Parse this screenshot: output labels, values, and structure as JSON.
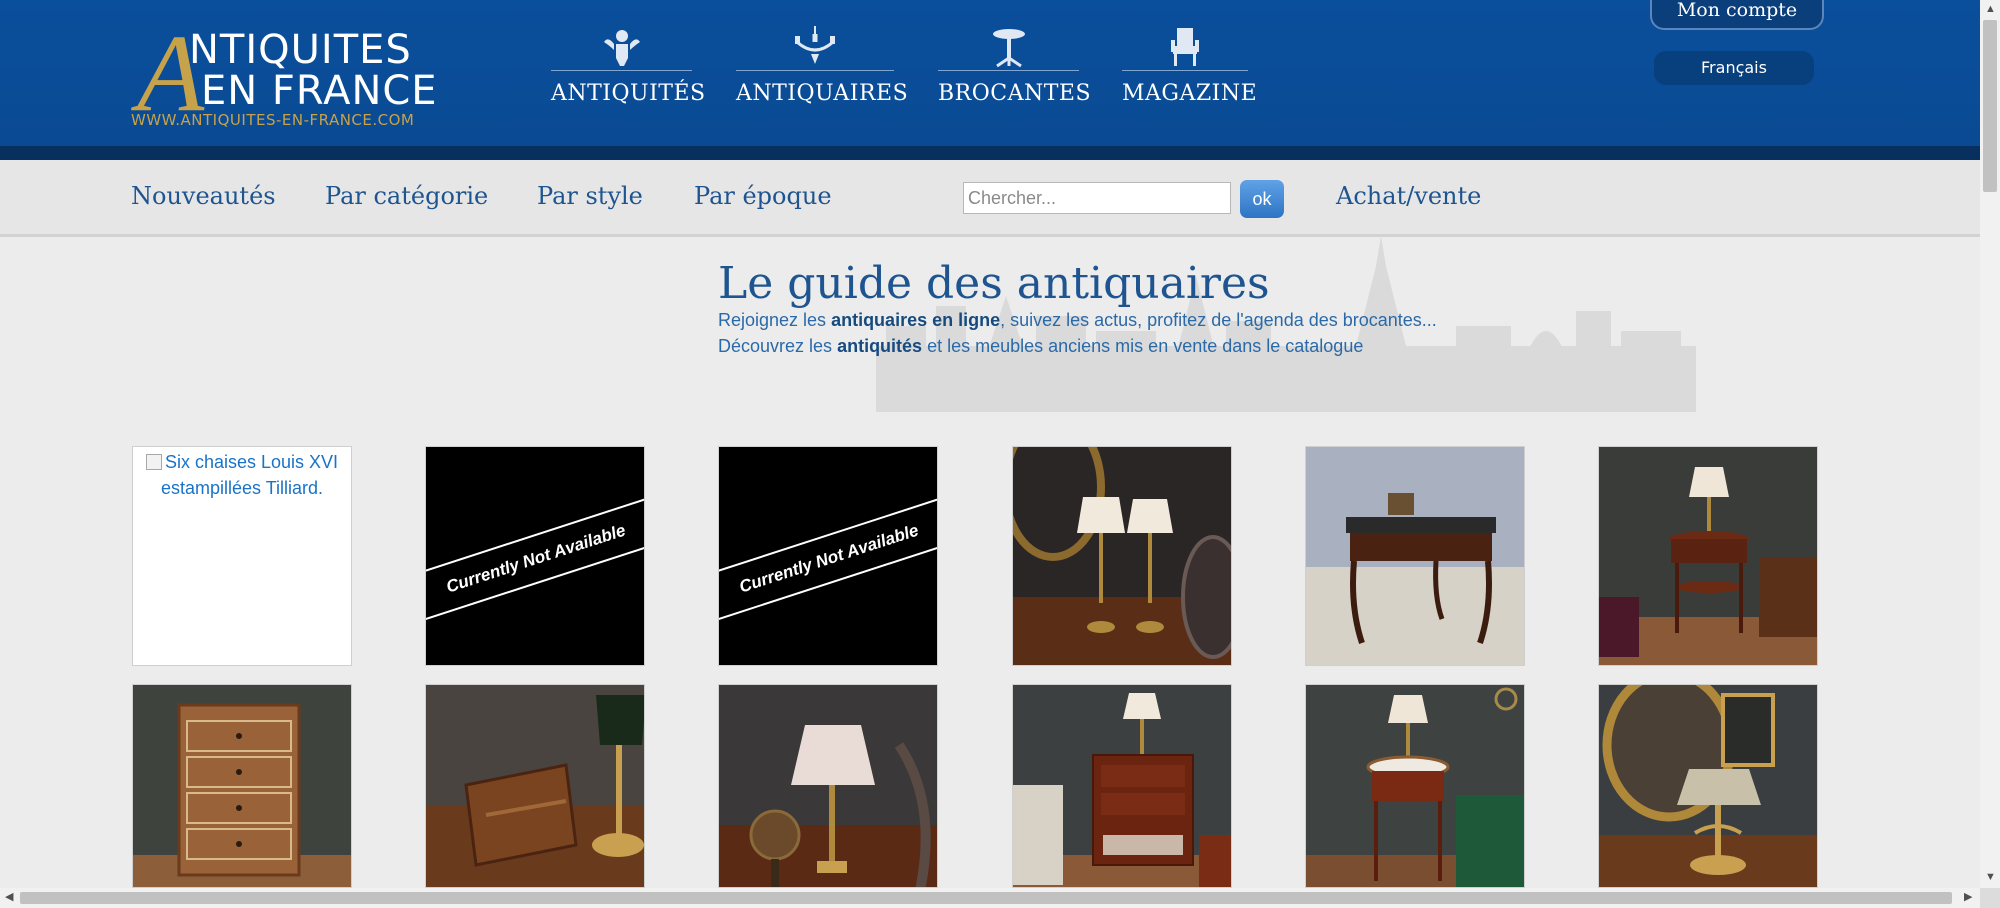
{
  "logo": {
    "initial": "A",
    "line1": "NTIQUITES",
    "line2": "EN FRANCE",
    "url": "WWW.ANTIQUITES-EN-FRANCE.COM"
  },
  "topnav": [
    {
      "label": "ANTIQUITÉS",
      "icon": "cherub-icon"
    },
    {
      "label": "ANTIQUAIRES",
      "icon": "chandelier-icon"
    },
    {
      "label": "BROCANTES",
      "icon": "gueridon-table-icon"
    },
    {
      "label": "MAGAZINE",
      "icon": "armchair-icon"
    }
  ],
  "account": {
    "label": "Mon compte"
  },
  "language": {
    "label": "Français"
  },
  "subnav": {
    "links": [
      "Nouveautés",
      "Par catégorie",
      "Par style",
      "Par époque"
    ],
    "search_placeholder": "Chercher...",
    "ok_label": "ok",
    "achat": "Achat/vente"
  },
  "hero": {
    "title": "Le guide des antiquaires",
    "line1": {
      "pre": "Rejoignez les ",
      "bold": "antiquaires en ligne",
      "post": ", suivez les actus, profitez de l'agenda des brocantes..."
    },
    "line2": {
      "pre": "Découvrez les ",
      "bold": "antiquités",
      "post": " et les meubles anciens mis en vente dans le catalogue"
    }
  },
  "grid": {
    "broken_alt": "Six chaises Louis XVI estampillées Tilliard.",
    "unavailable_text": "Currently Not Available"
  },
  "colors": {
    "header_blue": "#0a4f9c",
    "gold": "#c6a24a",
    "link_blue": "#1e5590"
  }
}
